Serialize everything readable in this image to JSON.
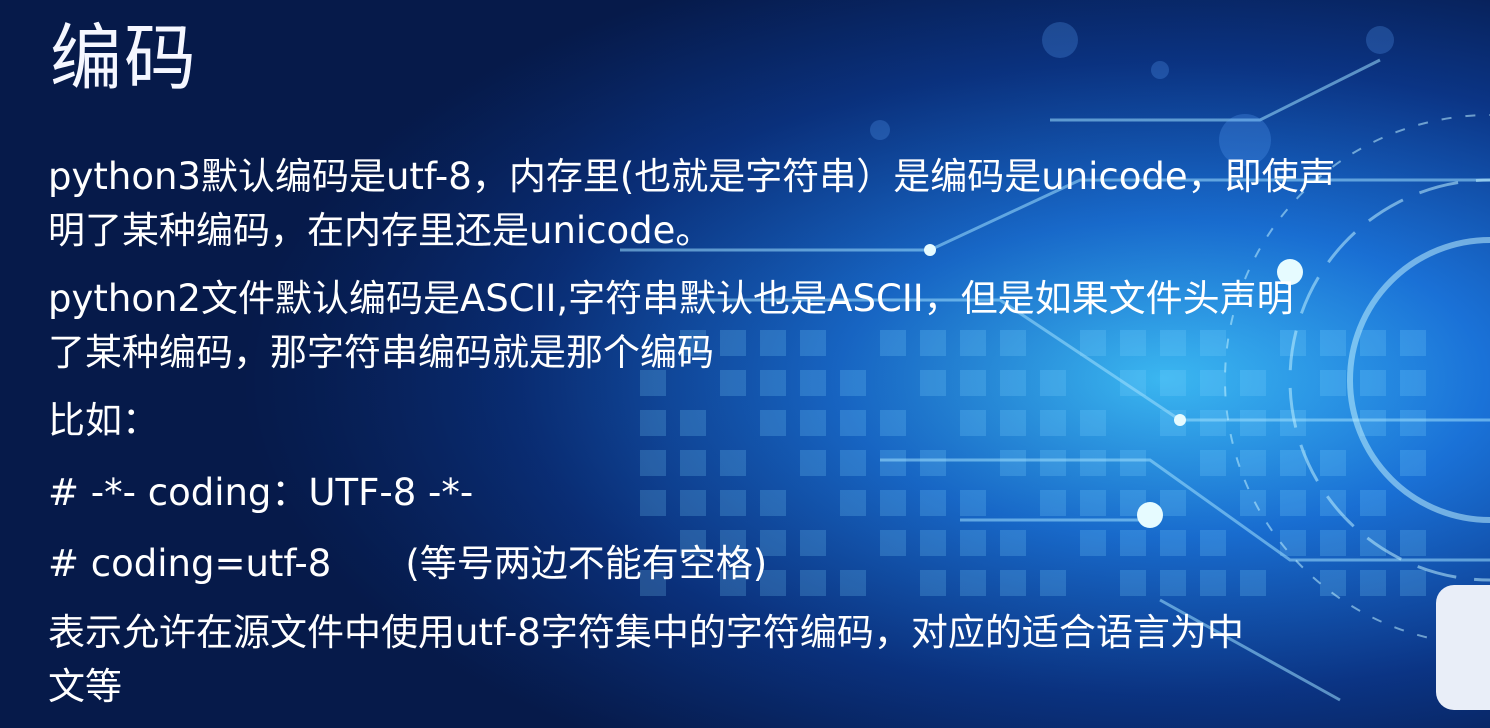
{
  "slide": {
    "title": "编码",
    "lines": {
      "py3_line1": "python3默认编码是utf-8，内存里(也就是字符串）是编码是unicode，即使声",
      "py3_line2": "明了某种编码，在内存里还是unicode。",
      "py2_line1": "python2文件默认编码是ASCII,字符串默认也是ASCII，但是如果文件头声明",
      "py2_line2": "了某种编码，那字符串编码就是那个编码",
      "example_label": "比如：",
      "code_example_1": "# -*- coding：UTF-8 -*-",
      "code_example_2": "# coding=utf-8",
      "code_note": "(等号两边不能有空格)",
      "meaning_line1": "表示允许在源文件中使用utf-8字符集中的字符编码，对应的适合语言为中",
      "meaning_line2": "文等"
    }
  },
  "colors": {
    "background_dark": "#061a4a",
    "background_glow": "#2aa8ff",
    "text": "#ffffff"
  }
}
